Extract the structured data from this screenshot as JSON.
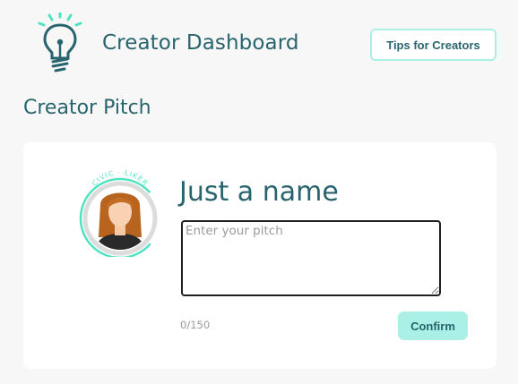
{
  "header": {
    "logo_icon": "lightbulb-icon",
    "title": "Creator Dashboard",
    "tips_button": "Tips for Creators"
  },
  "section": {
    "title": "Creator Pitch"
  },
  "card": {
    "avatar_icon": "civic-liker-avatar",
    "avatar_badge_text": "CIVIC · LIKER",
    "name": "Just a name",
    "pitch": {
      "value": "",
      "placeholder": "Enter your pitch"
    },
    "counter": "0/150",
    "confirm_button": "Confirm"
  },
  "colors": {
    "accent": "#aaf0e7",
    "brand_text": "#28646e",
    "badge_ring": "#50e3c2",
    "background": "#f7f7f7"
  }
}
